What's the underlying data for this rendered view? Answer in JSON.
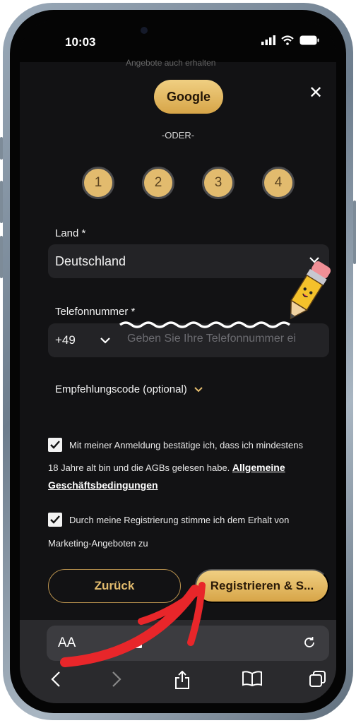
{
  "status": {
    "time": "10:03"
  },
  "header": {
    "partial_text": "Angebote auch erhalten",
    "google_label": "Google",
    "divider": "-ODER-"
  },
  "steps": [
    "1",
    "2",
    "3",
    "4"
  ],
  "country": {
    "label": "Land *",
    "value": "Deutschland"
  },
  "phone": {
    "label": "Telefonnummer *",
    "prefix": "+49",
    "placeholder": "Geben Sie Ihre Telefonnummer ei"
  },
  "referral": {
    "label": "Empfehlungscode (optional)"
  },
  "consent1": {
    "line1": "Mit meiner Anmeldung bestätige ich, dass ich mindestens",
    "line2": "18 Jahre alt bin und die AGBs gelesen habe.",
    "link1": "Allgemeine",
    "link2": "Geschäftsbedingungen"
  },
  "consent2": {
    "line1": "Durch meine Registrierung stimme ich dem Erhalt von",
    "line2": "Marketing-Angeboten zu"
  },
  "buttons": {
    "back": "Zurück",
    "register": "Registrieren & S..."
  },
  "browser": {
    "aa": "AA"
  },
  "colors": {
    "gold": "#e2bb6e",
    "background": "#121214",
    "annotation": "#e8262a"
  }
}
